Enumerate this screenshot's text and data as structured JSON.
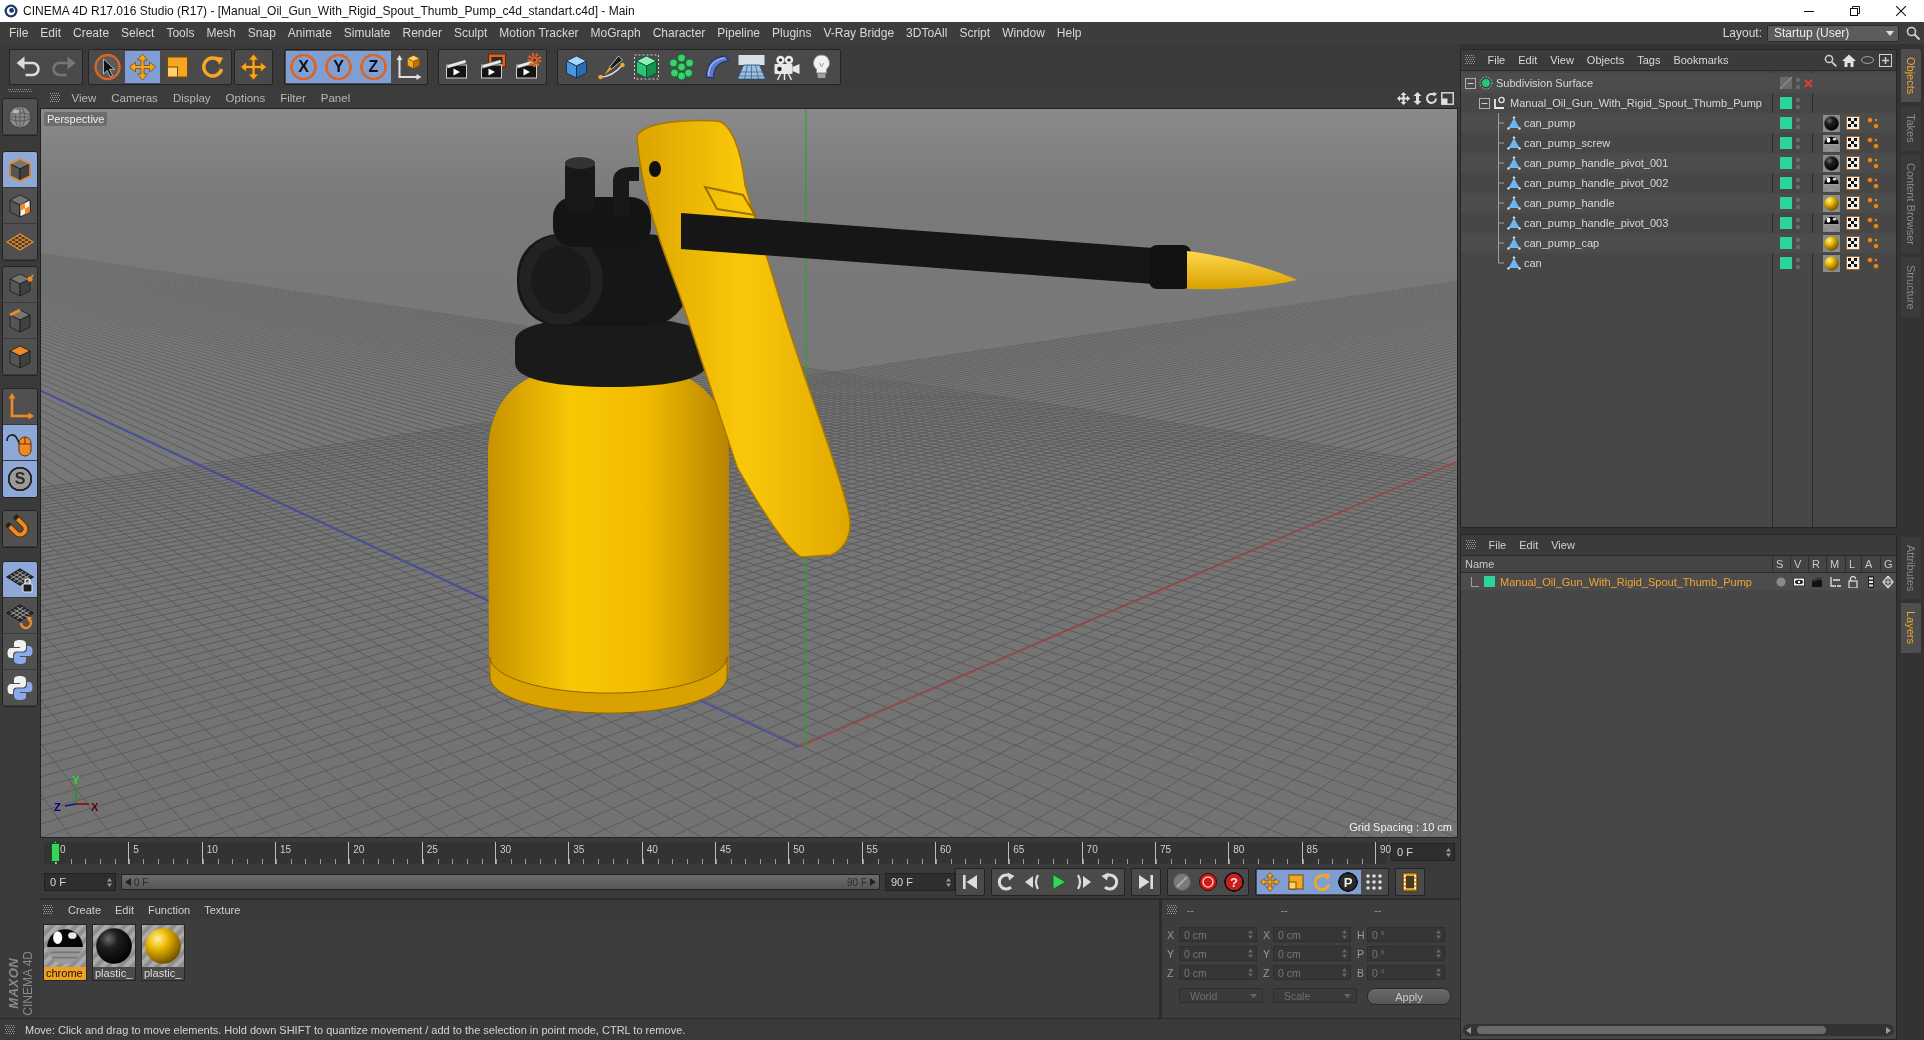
{
  "window": {
    "title": "CINEMA 4D R17.016 Studio (R17) - [Manual_Oil_Gun_With_Rigid_Spout_Thumb_Pump_c4d_standart.c4d] - Main"
  },
  "menu_bar": {
    "items": [
      "File",
      "Edit",
      "Create",
      "Select",
      "Tools",
      "Mesh",
      "Snap",
      "Animate",
      "Simulate",
      "Render",
      "Sculpt",
      "Motion Tracker",
      "MoGraph",
      "Character",
      "Pipeline",
      "Plugins",
      "V-Ray Bridge",
      "3DToAll",
      "Script",
      "Window",
      "Help"
    ],
    "layout_label": "Layout:",
    "layout_value": "Startup (User)"
  },
  "toolbar": [
    [
      {
        "kind": "undo",
        "disabled": false
      },
      {
        "kind": "redo",
        "disabled": true
      }
    ],
    [
      {
        "kind": "select",
        "selected": false
      },
      {
        "kind": "move",
        "selected": true
      },
      {
        "kind": "scale",
        "selected": false
      },
      {
        "kind": "rotate",
        "selected": false
      }
    ],
    [
      {
        "kind": "last-tool"
      }
    ],
    [
      {
        "kind": "axis",
        "label": "X",
        "selected": true
      },
      {
        "kind": "axis",
        "label": "Y",
        "selected": true
      },
      {
        "kind": "axis",
        "label": "Z",
        "selected": true
      },
      {
        "kind": "coordinates",
        "selected": false
      }
    ],
    [
      {
        "kind": "render-view"
      },
      {
        "kind": "render-picture"
      },
      {
        "kind": "render-settings"
      }
    ],
    [
      {
        "kind": "cube"
      },
      {
        "kind": "pen"
      },
      {
        "kind": "subdivision"
      },
      {
        "kind": "cloner"
      },
      {
        "kind": "bend"
      },
      {
        "kind": "floor"
      },
      {
        "kind": "camera"
      },
      {
        "kind": "light"
      }
    ]
  ],
  "left_tools": [
    {
      "kind": "globe",
      "selected": false
    },
    {
      "kind": "model",
      "selected": true
    },
    {
      "kind": "texture",
      "selected": false
    },
    {
      "kind": "workplane",
      "selected": false
    },
    {
      "kind": "points",
      "selected": false
    },
    {
      "kind": "edges",
      "selected": false
    },
    {
      "kind": "polygons",
      "selected": false
    },
    {
      "kind": "axis",
      "selected": false
    },
    {
      "kind": "tweak",
      "selected": true
    },
    {
      "kind": "snap",
      "label": "S",
      "selected": true
    },
    {
      "kind": "magnet",
      "selected": false
    },
    {
      "kind": "grid-lock",
      "selected": true
    },
    {
      "kind": "grid-rotate",
      "selected": false
    },
    {
      "kind": "python",
      "selected": false
    },
    {
      "kind": "python",
      "selected": false
    }
  ],
  "viewport": {
    "menu": [
      "View",
      "Cameras",
      "Display",
      "Options",
      "Filter",
      "Panel"
    ],
    "camera": "Perspective",
    "grid_spacing": "Grid Spacing : 10 cm",
    "gizmo_labels": [
      "Y",
      "Z",
      "X"
    ]
  },
  "timeline": {
    "ticks": [
      "0",
      "5",
      "10",
      "15",
      "20",
      "25",
      "30",
      "35",
      "40",
      "45",
      "50",
      "55",
      "60",
      "65",
      "70",
      "75",
      "80",
      "85",
      "90"
    ],
    "level": 0,
    "frame": "0 F"
  },
  "playback": {
    "start": "0 F",
    "range": {
      "start": "0 F",
      "end": "90 F"
    },
    "end": "90 F",
    "groups": [
      [
        {
          "kind": "go-start"
        }
      ],
      [
        {
          "kind": "loop-back"
        },
        {
          "kind": "prev-key"
        },
        {
          "kind": "play"
        },
        {
          "kind": "next-key"
        },
        {
          "kind": "loop"
        }
      ],
      [
        {
          "kind": "go-end"
        }
      ],
      [
        {
          "kind": "autokey"
        },
        {
          "kind": "record"
        },
        {
          "kind": "key-select",
          "label": "?"
        }
      ],
      [
        {
          "kind": "key-move",
          "selected": true
        },
        {
          "kind": "key-scale",
          "selected": true
        },
        {
          "kind": "key-rotate",
          "selected": true
        },
        {
          "kind": "key-param",
          "label": "P",
          "selected": true
        },
        {
          "kind": "key-points",
          "selected": false
        }
      ],
      [
        {
          "kind": "timeline"
        }
      ]
    ]
  },
  "materials": {
    "menu": [
      "Create",
      "Edit",
      "Function",
      "Texture"
    ],
    "items": [
      {
        "name": "chrome",
        "kind": "chrome",
        "selected": true
      },
      {
        "name": "plastic_",
        "kind": "black",
        "selected": false
      },
      {
        "name": "plastic_",
        "kind": "yellow",
        "selected": false
      }
    ]
  },
  "logo": {
    "brand": "MAXON",
    "product": "CINEMA 4D"
  },
  "coordinates": {
    "headers": [
      "--",
      "--",
      "--"
    ],
    "rows": [
      {
        "pos_axis": "X",
        "position": "0 cm",
        "size_axis": "X",
        "size": "0 cm",
        "rot_axis": "H",
        "rotation": "0 °"
      },
      {
        "pos_axis": "Y",
        "position": "0 cm",
        "size_axis": "Y",
        "size": "0 cm",
        "rot_axis": "P",
        "rotation": "0 °"
      },
      {
        "pos_axis": "Z",
        "position": "0 cm",
        "size_axis": "Z",
        "size": "0 cm",
        "rot_axis": "B",
        "rotation": "0 °"
      }
    ],
    "mode": "World",
    "size_mode": "Scale",
    "apply": "Apply"
  },
  "status_bar": "Move: Click and drag to move elements. Hold down SHIFT to quantize movement / add to the selection in point mode, CTRL to remove.",
  "objects": {
    "menu": [
      "File",
      "Edit",
      "View",
      "Objects",
      "Tags",
      "Bookmarks"
    ],
    "tree": [
      {
        "name": "Subdivision Surface",
        "kind": "subdivision",
        "enabled": false,
        "expanded": true,
        "children": [
          {
            "name": "Manual_Oil_Gun_With_Rigid_Spout_Thumb_Pump",
            "kind": "null",
            "color": "#2bd49b",
            "expanded": true,
            "children": [
              {
                "name": "can_pump",
                "kind": "polygon",
                "color": "#2bd49b",
                "material_tag": {
                  "kind": "black"
                }
              },
              {
                "name": "can_pump_screw",
                "kind": "polygon",
                "color": "#2bd49b",
                "material_tag": {
                  "kind": "chrome"
                }
              },
              {
                "name": "can_pump_handle_pivot_001",
                "kind": "polygon",
                "color": "#2bd49b",
                "material_tag": {
                  "kind": "black"
                }
              },
              {
                "name": "can_pump_handle_pivot_002",
                "kind": "polygon",
                "color": "#2bd49b",
                "material_tag": {
                  "kind": "chrome"
                }
              },
              {
                "name": "can_pump_handle",
                "kind": "polygon",
                "color": "#2bd49b",
                "material_tag": {
                  "kind": "yellow"
                }
              },
              {
                "name": "can_pump_handle_pivot_003",
                "kind": "polygon",
                "color": "#2bd49b",
                "material_tag": {
                  "kind": "chrome"
                }
              },
              {
                "name": "can_pump_cap",
                "kind": "polygon",
                "color": "#2bd49b",
                "material_tag": {
                  "kind": "yellow"
                }
              },
              {
                "name": "can",
                "kind": "polygon",
                "color": "#2bd49b",
                "material_tag": {
                  "kind": "yellow"
                }
              }
            ]
          }
        ]
      }
    ]
  },
  "side_tabs_top": [
    {
      "label": "Objects",
      "selected": true
    },
    {
      "label": "Takes",
      "selected": false
    },
    {
      "label": "Content Browser",
      "selected": false
    },
    {
      "label": "Structure",
      "selected": false
    }
  ],
  "layers": {
    "menu": [
      "File",
      "Edit",
      "View"
    ],
    "columns": [
      "Name",
      "S",
      "V",
      "R",
      "M",
      "L",
      "A",
      "G"
    ],
    "rows": [
      {
        "name": "Manual_Oil_Gun_With_Rigid_Spout_Thumb_Pump",
        "color": "#2bd49b",
        "selected": true
      }
    ]
  },
  "side_tabs_bottom": [
    {
      "label": "Attributes",
      "selected": false
    },
    {
      "label": "Layers",
      "selected": true
    }
  ]
}
